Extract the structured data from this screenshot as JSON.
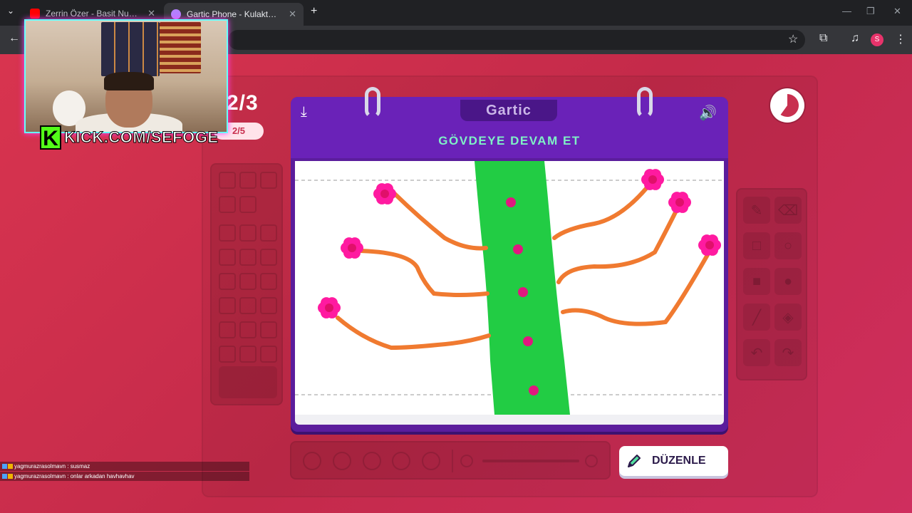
{
  "browser": {
    "tabs": [
      {
        "title": "Zerrin Özer - Basit Numaralar (",
        "favicon": "youtube-icon",
        "favicon_color": "#ff0000",
        "active": false
      },
      {
        "title": "Gartic Phone - Kulaktan Kulağa",
        "favicon": "phone-icon",
        "favicon_color": "#b480ff",
        "active": true
      }
    ],
    "profile_initial": "S"
  },
  "game": {
    "round": "2/3",
    "round_badge": "2/5",
    "logo": "Gartic",
    "prompt": "GÖVDEYE DEVAM ET",
    "edit_button": "DÜZENLE",
    "timer_progress": 0.6
  },
  "stream": {
    "kick_letter": "K",
    "kick_url": "KICK.COM/SEFOGE"
  },
  "chat": [
    {
      "user": "yagmurazrasolmavn",
      "message": "susmaz",
      "line": "yagmurazrasolmavn : susmaz"
    },
    {
      "user": "yagmurazrasolmavn",
      "message": "onlar arkadan havhavhav",
      "line": "yagmurazrasolmavn : onlar arkadan havhavhav"
    }
  ],
  "colors": {
    "background": "#c8304f",
    "book": "#5b1d9c",
    "prompt": "#7ff0c6",
    "trunk": "#22cc44",
    "branch": "#f07a30",
    "flower": "#ff1aa0",
    "kick": "#53fc18"
  }
}
